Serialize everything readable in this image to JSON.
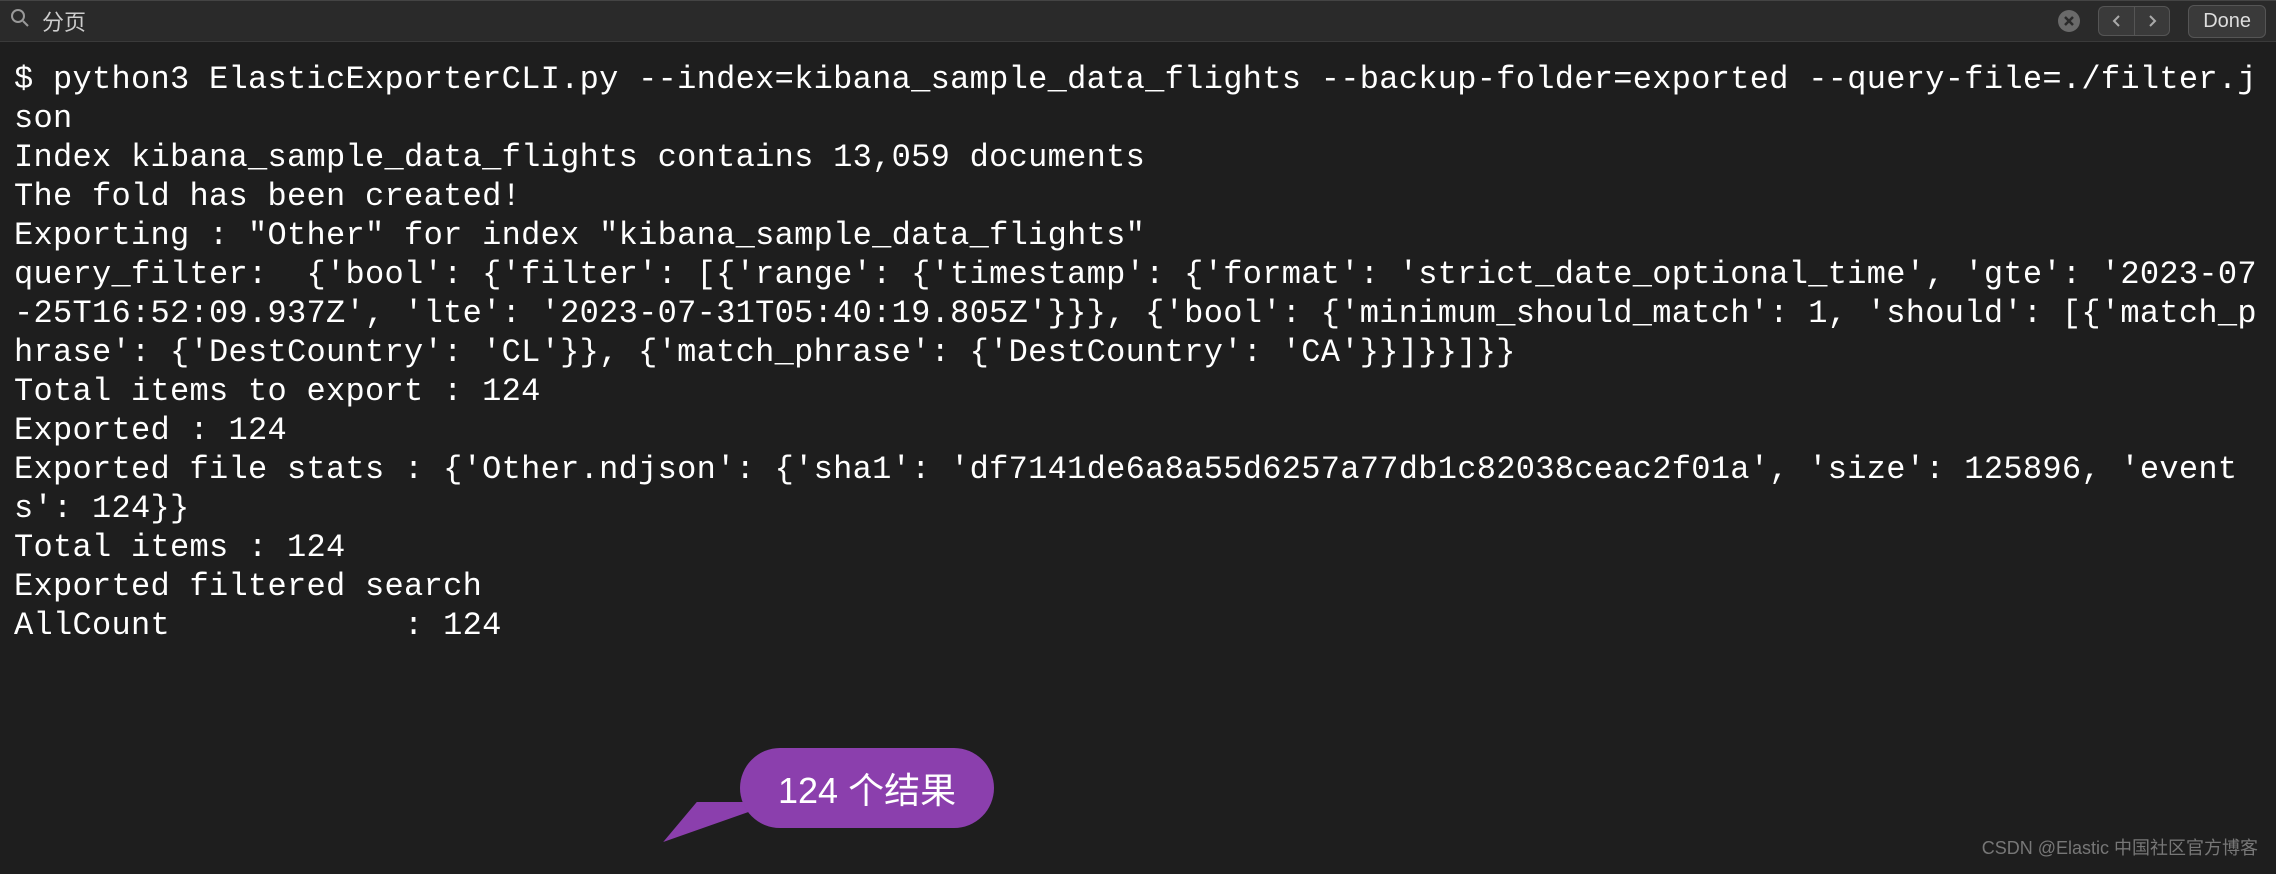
{
  "search": {
    "value": "分页",
    "done_label": "Done"
  },
  "terminal": {
    "content": "$ python3 ElasticExporterCLI.py --index=kibana_sample_data_flights --backup-folder=exported --query-file=./filter.json\nIndex kibana_sample_data_flights contains 13,059 documents\nThe fold has been created!\nExporting : \"Other\" for index \"kibana_sample_data_flights\"\nquery_filter:  {'bool': {'filter': [{'range': {'timestamp': {'format': 'strict_date_optional_time', 'gte': '2023-07-25T16:52:09.937Z', 'lte': '2023-07-31T05:40:19.805Z'}}}, {'bool': {'minimum_should_match': 1, 'should': [{'match_phrase': {'DestCountry': 'CL'}}, {'match_phrase': {'DestCountry': 'CA'}}]}}]}}\nTotal items to export : 124\nExported : 124\nExported file stats : {'Other.ndjson': {'sha1': 'df7141de6a8a55d6257a77db1c82038ceac2f01a', 'size': 125896, 'events': 124}}\nTotal items : 124\nExported filtered search\nAllCount            : 124"
  },
  "callout": {
    "text": "124 个结果"
  },
  "watermark": {
    "text": "CSDN @Elastic 中国社区官方博客"
  }
}
